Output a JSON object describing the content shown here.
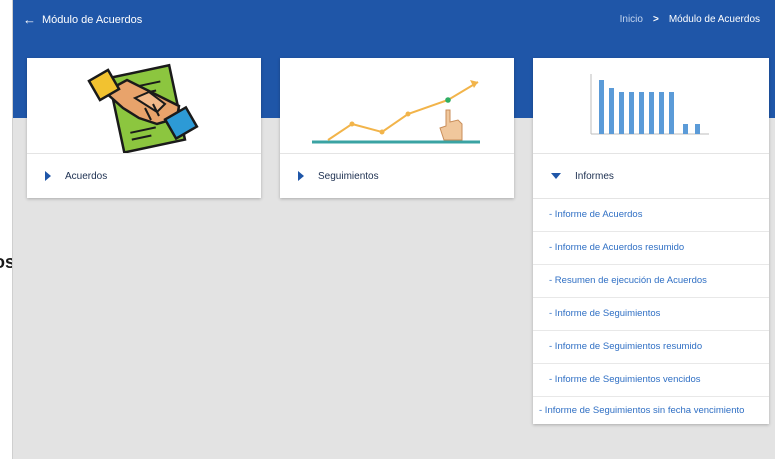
{
  "header": {
    "back_icon": "arrow-left-icon",
    "title": "Módulo de Acuerdos",
    "breadcrumb": {
      "home": "Inicio",
      "separator": ">",
      "current": "Módulo de Acuerdos"
    }
  },
  "cards": [
    {
      "label": "Acuerdos",
      "icon": "handshake-contract-icon",
      "expanded": false
    },
    {
      "label": "Seguimientos",
      "icon": "line-chart-touch-icon",
      "expanded": false
    },
    {
      "label": "Informes",
      "icon": "bar-chart-icon",
      "expanded": true,
      "items": [
        "- Informe de Acuerdos",
        "- Informe de Acuerdos resumido",
        "- Resumen de ejecución de Acuerdos",
        "- Informe de Seguimientos",
        "- Informe de Seguimientos resumido",
        "- Informe de Seguimientos vencidos",
        "- Informe de Seguimientos sin fecha vencimiento"
      ]
    }
  ],
  "side_text": "os",
  "colors": {
    "primary": "#1f56a8",
    "link": "#2f6fc4",
    "background": "#e3e3e3"
  }
}
